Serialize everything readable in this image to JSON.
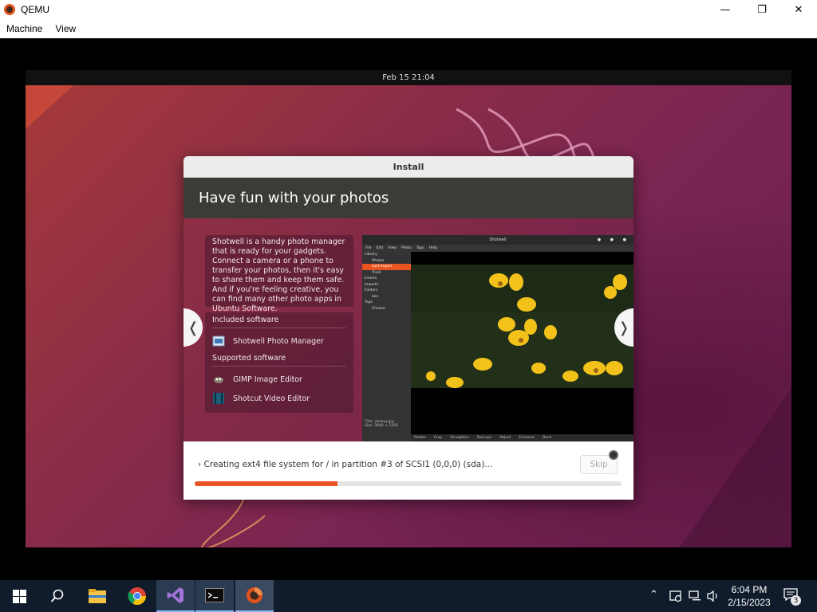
{
  "qemu": {
    "title": "QEMU",
    "menu": [
      "Machine",
      "View"
    ],
    "controls": {
      "minimize_icon": "minimize-icon",
      "restore_icon": "restore-icon",
      "close_icon": "close-icon"
    }
  },
  "guest": {
    "topbar_clock": "Feb 15  21:04",
    "dialog": {
      "title": "Install",
      "slide_title": "Have fun with your photos",
      "description": "Shotwell is a handy photo manager that is ready for your gadgets. Connect a camera or a phone to transfer your photos, then it's easy to share them and keep them safe. And if you're feeling creative, you can find many other photo apps in Ubuntu Software.",
      "included_heading": "Included software",
      "included": [
        {
          "label": "Shotwell Photo Manager",
          "icon": "shotwell-icon"
        }
      ],
      "supported_heading": "Supported software",
      "supported": [
        {
          "label": "GIMP Image Editor",
          "icon": "gimp-icon"
        },
        {
          "label": "Shotcut Video Editor",
          "icon": "shotcut-icon"
        }
      ],
      "screenshot": {
        "window_title": "Shotwell",
        "menu": [
          "File",
          "Edit",
          "View",
          "Photo",
          "Tags",
          "Help"
        ],
        "sidebar": [
          "Library",
          "Photos",
          "Last Import",
          "Trash",
          "Events",
          "Imports",
          "Folders",
          "ken",
          "Tags",
          "Cheese"
        ],
        "status": [
          "Title:  donkey.jpg",
          "Size:  3840 × 2160"
        ],
        "toolbar": [
          "Rotate",
          "Crop",
          "Straighten",
          "Red-eye",
          "Adjust",
          "Enhance",
          "Done"
        ]
      },
      "status_text": "Creating ext4 file system for / in partition #3 of SCSI1 (0,0,0) (sda)...",
      "skip_label": "Skip",
      "progress_fraction": 0.335
    }
  },
  "taskbar": {
    "apps": [
      "start-icon",
      "search-icon",
      "file-explorer-icon",
      "chrome-icon",
      "visual-studio-icon",
      "terminal-icon",
      "qemu-icon"
    ],
    "time": "6:04 PM",
    "date": "2/15/2023",
    "notification_count": "3"
  }
}
